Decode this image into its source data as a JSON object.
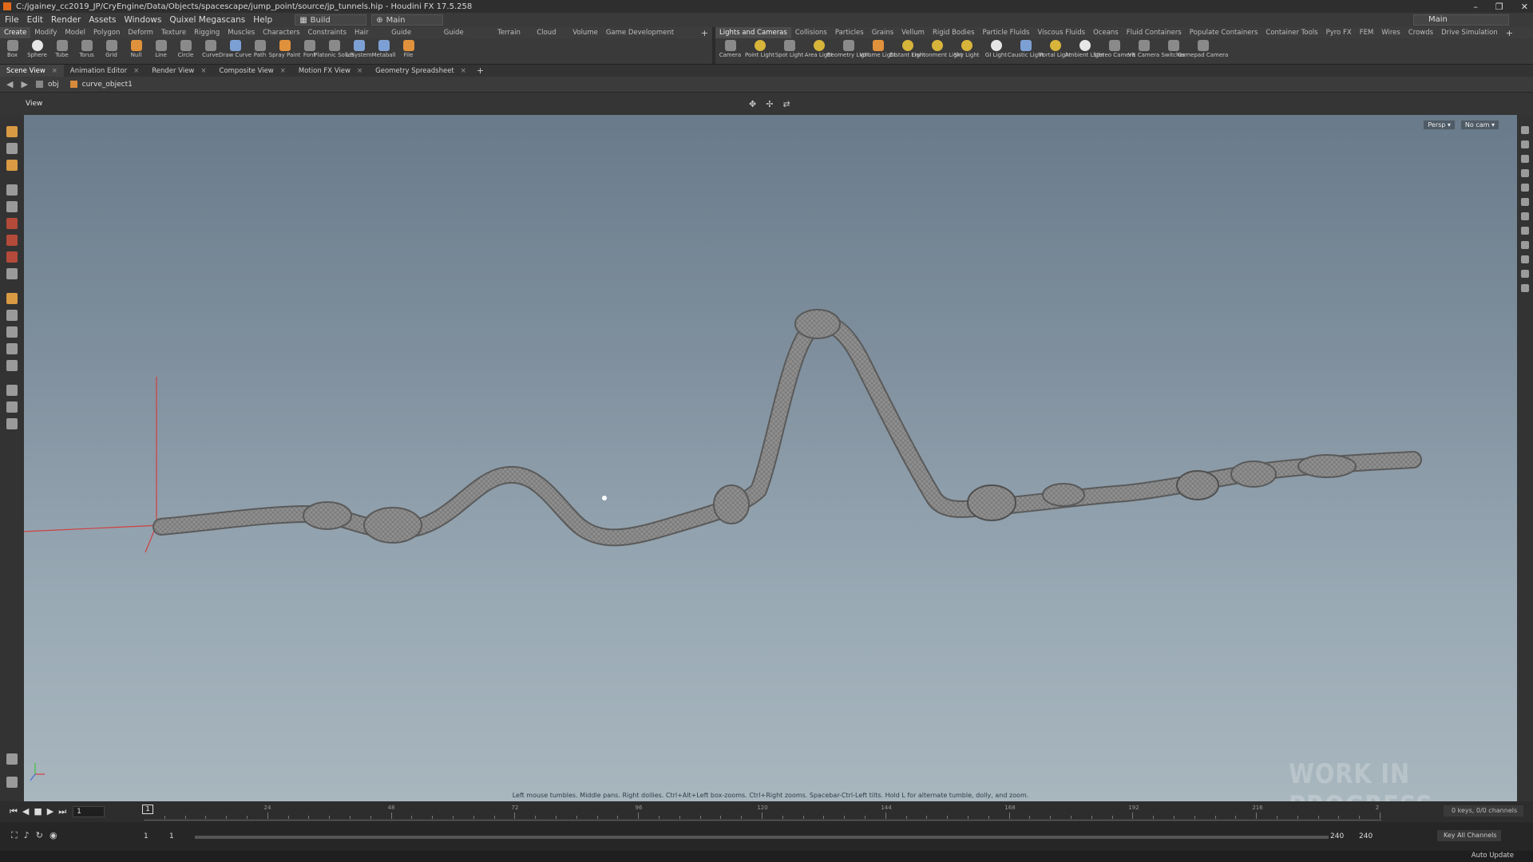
{
  "window": {
    "title": "C:/jgainey_cc2019_JP/CryEngine/Data/Objects/spacescape/jump_point/source/jp_tunnels.hip - Houdini FX 17.5.258",
    "controls": [
      "–",
      "❐",
      "✕"
    ]
  },
  "menu": {
    "items": [
      "File",
      "Edit",
      "Render",
      "Assets",
      "Windows",
      "Quixel Megascans",
      "Help"
    ],
    "desktop": "Build",
    "main_view": "Main",
    "right_desktop": "Main"
  },
  "shelf_left": {
    "tabs": [
      "Create",
      "Modify",
      "Model",
      "Polygon",
      "Deform",
      "Texture",
      "Rigging",
      "Muscles",
      "Characters",
      "Constraints",
      "Hair Utils",
      "Guide Process",
      "Guide Brushes",
      "Terrain FX",
      "Cloud FX",
      "Volume",
      "Game Development Toolset"
    ],
    "tools": [
      "Box",
      "Sphere",
      "Tube",
      "Torus",
      "Grid",
      "Null",
      "Line",
      "Circle",
      "Curve",
      "Draw Curve",
      "Path",
      "Spray Paint",
      "Font",
      "Platonic Solids",
      "L-System",
      "Metaball",
      "File"
    ]
  },
  "shelf_right": {
    "tabs": [
      "Lights and Cameras",
      "Collisions",
      "Particles",
      "Grains",
      "Vellum",
      "Rigid Bodies",
      "Particle Fluids",
      "Viscous Fluids",
      "Oceans",
      "Fluid Containers",
      "Populate Containers",
      "Container Tools",
      "Pyro FX",
      "FEM",
      "Wires",
      "Crowds",
      "Drive Simulation"
    ],
    "tools": [
      "Camera",
      "Point Light",
      "Spot Light",
      "Area Light",
      "Geometry Light",
      "Volume Light",
      "Distant Light",
      "Environment Light",
      "Sky Light",
      "GI Light",
      "Caustic Light",
      "Portal Light",
      "Ambient Light",
      "Stereo Camera",
      "VR Camera",
      "Switcher",
      "Gamepad Camera"
    ]
  },
  "pane_tabs": [
    "Scene View",
    "Animation Editor",
    "Render View",
    "Composite View",
    "Motion FX View",
    "Geometry Spreadsheet"
  ],
  "path": {
    "context": "obj",
    "node": "curve_object1"
  },
  "viewer": {
    "label": "View",
    "persp": "Persp ▾",
    "camera": "No cam ▾",
    "watermark": "WORK IN PROGRESS",
    "hint": "Left mouse tumbles. Middle pans. Right dollies. Ctrl+Alt+Left box-zooms. Ctrl+Right zooms. Spacebar-Ctrl-Left tilts. Hold L for alternate tumble, dolly, and zoom."
  },
  "timeline": {
    "current_frame": "1",
    "cursor_label": "1",
    "tick_labels": [
      "24",
      "48",
      "72",
      "96",
      "120",
      "144",
      "168",
      "192",
      "216",
      "2"
    ],
    "keys_info": "0 keys, 0/0 channels",
    "key_all": "Key All Channels"
  },
  "range": {
    "start": "1",
    "start2": "1",
    "end": "240",
    "end2": "240"
  },
  "status": {
    "auto_update": "Auto Update"
  },
  "colors": {
    "viewport_top": "#697b8b",
    "viewport_bottom": "#a8b6be",
    "geometry": "#8d8d8d",
    "axis_red": "#d04040"
  }
}
